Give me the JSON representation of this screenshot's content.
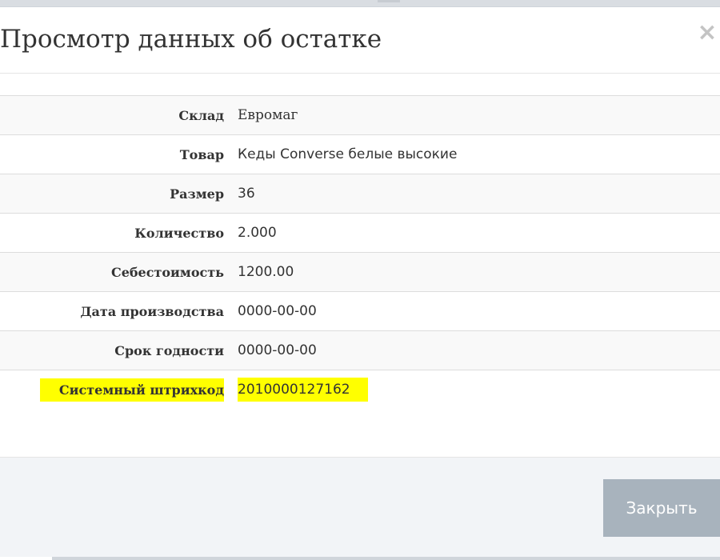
{
  "modal": {
    "title": "Просмотр данных об остатке",
    "close_icon": "×"
  },
  "details": {
    "rows": [
      {
        "label": "Склад",
        "value": "Евромаг"
      },
      {
        "label": "Товар",
        "value": "Кеды Converse белые высокие"
      },
      {
        "label": "Размер",
        "value": "36"
      },
      {
        "label": "Количество",
        "value": "2.000"
      },
      {
        "label": "Себестоимость",
        "value": "1200.00"
      },
      {
        "label": "Дата производства",
        "value": "0000-00-00"
      },
      {
        "label": "Срок годности",
        "value": "0000-00-00"
      },
      {
        "label": "Системный штрихкод",
        "value": "2010000127162"
      }
    ],
    "highlight_color": "#ffff00"
  },
  "footer": {
    "close_label": "Закрыть",
    "close_color": "#a8b3bd"
  }
}
